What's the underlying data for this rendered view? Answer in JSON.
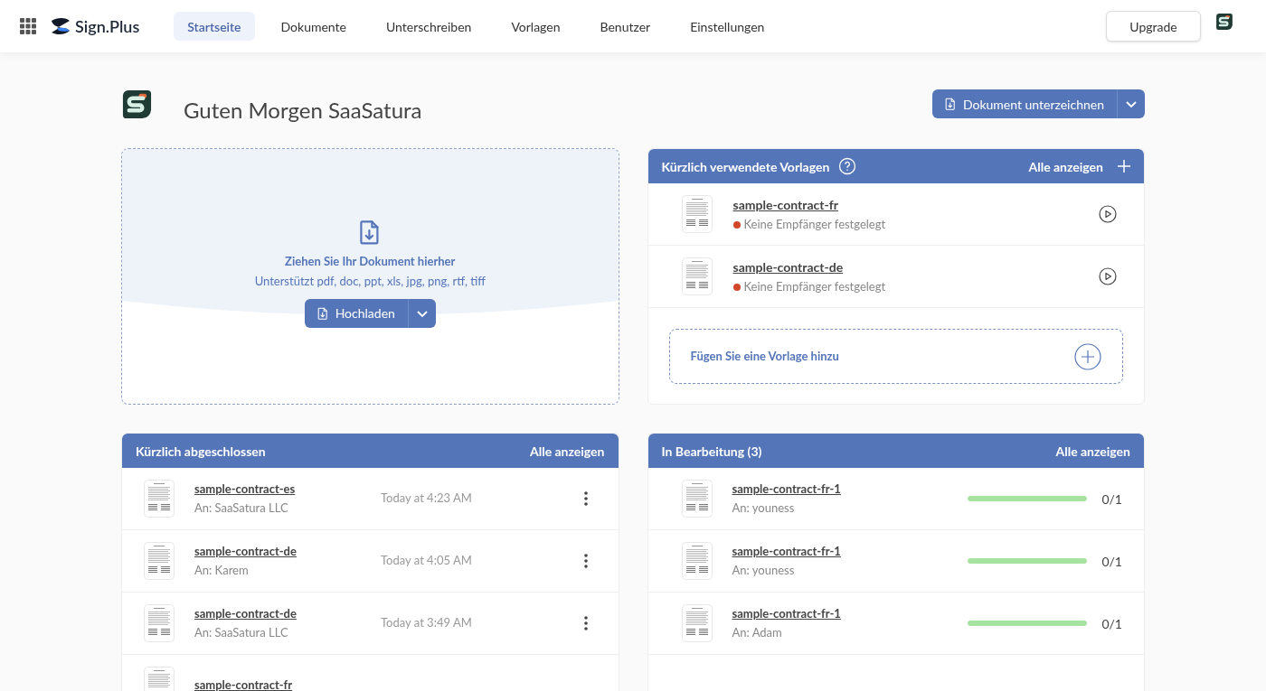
{
  "nav": {
    "brand": "Sign.Plus",
    "items": [
      {
        "label": "Startseite",
        "selected": true
      },
      {
        "label": "Dokumente",
        "selected": false
      },
      {
        "label": "Unterschreiben",
        "selected": false
      },
      {
        "label": "Vorlagen",
        "selected": false
      },
      {
        "label": "Benutzer",
        "selected": false
      },
      {
        "label": "Einstellungen",
        "selected": false
      }
    ],
    "upgrade": "Upgrade"
  },
  "greeting": "Guten Morgen SaaSatura",
  "sign_button": "Dokument unterzeichnen",
  "upload": {
    "title": "Ziehen Sie Ihr Dokument hierher",
    "formats": "Unterstützt pdf, doc, ppt, xls, jpg, png, rtf, tiff",
    "button": "Hochladen"
  },
  "templates": {
    "title": "Kürzlich verwendete Vorlagen",
    "show_all": "Alle anzeigen",
    "items": [
      {
        "name": "sample-contract-fr",
        "status": "Keine Empfänger festgelegt",
        "color": "#d2462a"
      },
      {
        "name": "sample-contract-de",
        "status": "Keine Empfänger festgelegt",
        "color": "#d2462a"
      }
    ],
    "add": "Fügen Sie eine Vorlage hinzu"
  },
  "completed": {
    "title": "Kürzlich abgeschlossen",
    "show_all": "Alle anzeigen",
    "rows": [
      {
        "name": "sample-contract-es",
        "recipient": "An: SaaSatura LLC",
        "time": "Today at 4:23 AM"
      },
      {
        "name": "sample-contract-de",
        "recipient": "An: Karem",
        "time": "Today at 4:05 AM"
      },
      {
        "name": "sample-contract-de",
        "recipient": "An: SaaSatura LLC",
        "time": "Today at 3:49 AM"
      },
      {
        "name": "sample-contract-fr"
      }
    ]
  },
  "in_progress": {
    "title": "In Bearbeitung (3)",
    "show_all": "Alle anzeigen",
    "rows": [
      {
        "name": "sample-contract-fr-1",
        "recipient": "An: youness",
        "level": 1,
        "count": "0/1"
      },
      {
        "name": "sample-contract-fr-1",
        "recipient": "An: youness",
        "level": 1,
        "count": "0/1"
      },
      {
        "name": "sample-contract-fr-1",
        "recipient": "An: Adam",
        "level": 1,
        "count": "0/1"
      }
    ]
  }
}
